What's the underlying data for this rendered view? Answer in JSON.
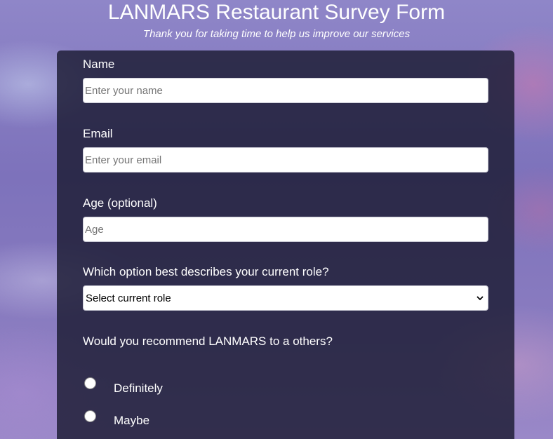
{
  "header": {
    "title": "LANMARS Restaurant Survey Form",
    "subtitle": "Thank you for taking time to help us improve our services"
  },
  "form": {
    "name": {
      "label": "Name",
      "placeholder": "Enter your name",
      "value": ""
    },
    "email": {
      "label": "Email",
      "placeholder": "Enter your email",
      "value": ""
    },
    "age": {
      "label": "Age (optional)",
      "placeholder": "Age",
      "value": ""
    },
    "role": {
      "label": "Which option best describes your current role?",
      "selected": "Select current role",
      "icon": "chevron-down-icon"
    },
    "recommend": {
      "question": "Would you recommend LANMARS to a others?",
      "options": [
        {
          "label": "Definitely",
          "checked": false
        },
        {
          "label": "Maybe",
          "checked": false
        }
      ]
    }
  },
  "colors": {
    "card_background": "#1b1b32",
    "text": "#ffffff",
    "input_background": "#ffffff"
  }
}
